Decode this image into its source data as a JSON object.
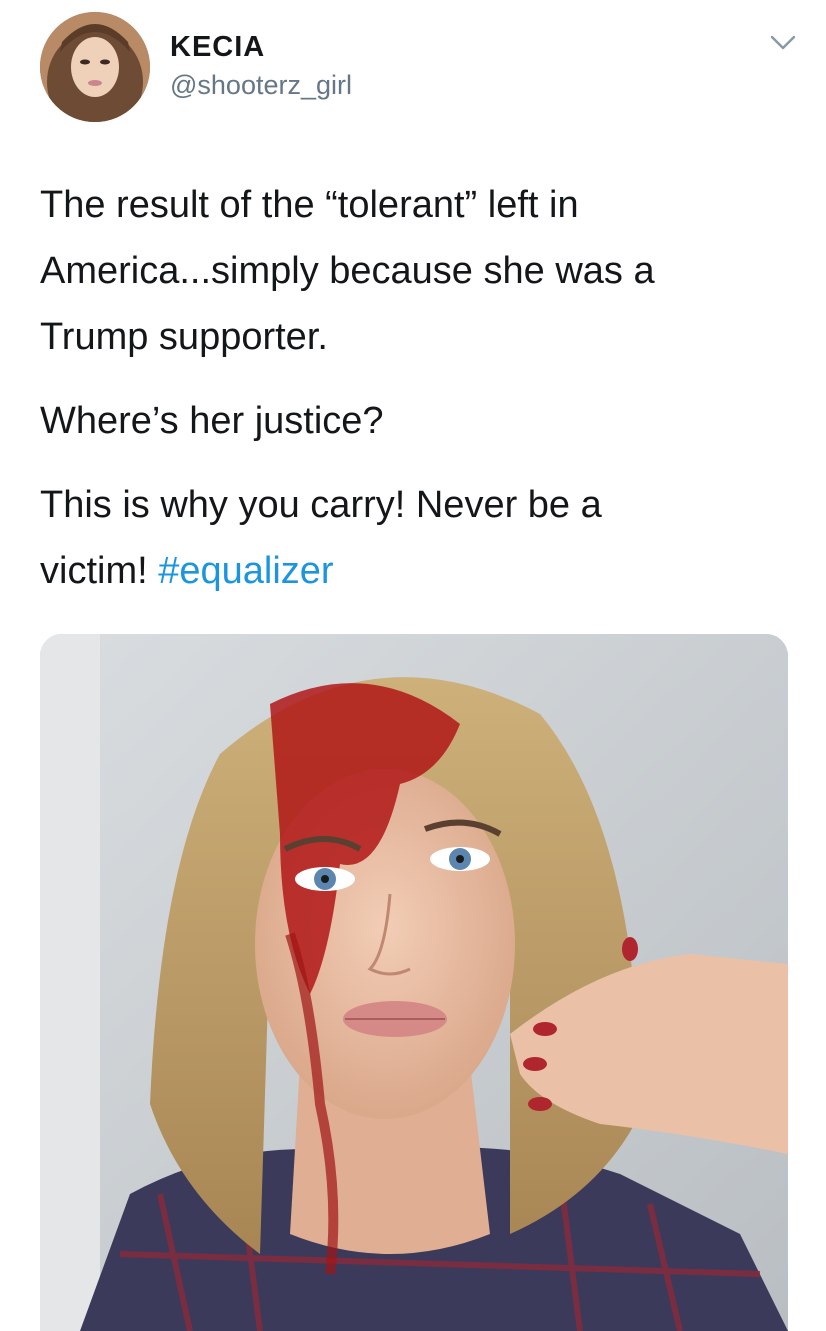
{
  "tweet": {
    "author": {
      "display_name": "KECIA",
      "handle": "@shooterz_girl",
      "avatar_icon": "profile-photo"
    },
    "menu_icon": "chevron-down-icon",
    "text": {
      "line1": "The result of the “tolerant” left in",
      "line2": "America...simply because she was a",
      "line3": "Trump supporter.",
      "line4": "Where’s her justice?",
      "line5": "This is why you carry! Never be a",
      "line6_prefix": "victim! ",
      "hashtag": "#equalizer"
    },
    "colors": {
      "text": "#14171a",
      "secondary": "#657786",
      "link": "#1b95e0"
    },
    "media": {
      "type": "photo"
    }
  }
}
